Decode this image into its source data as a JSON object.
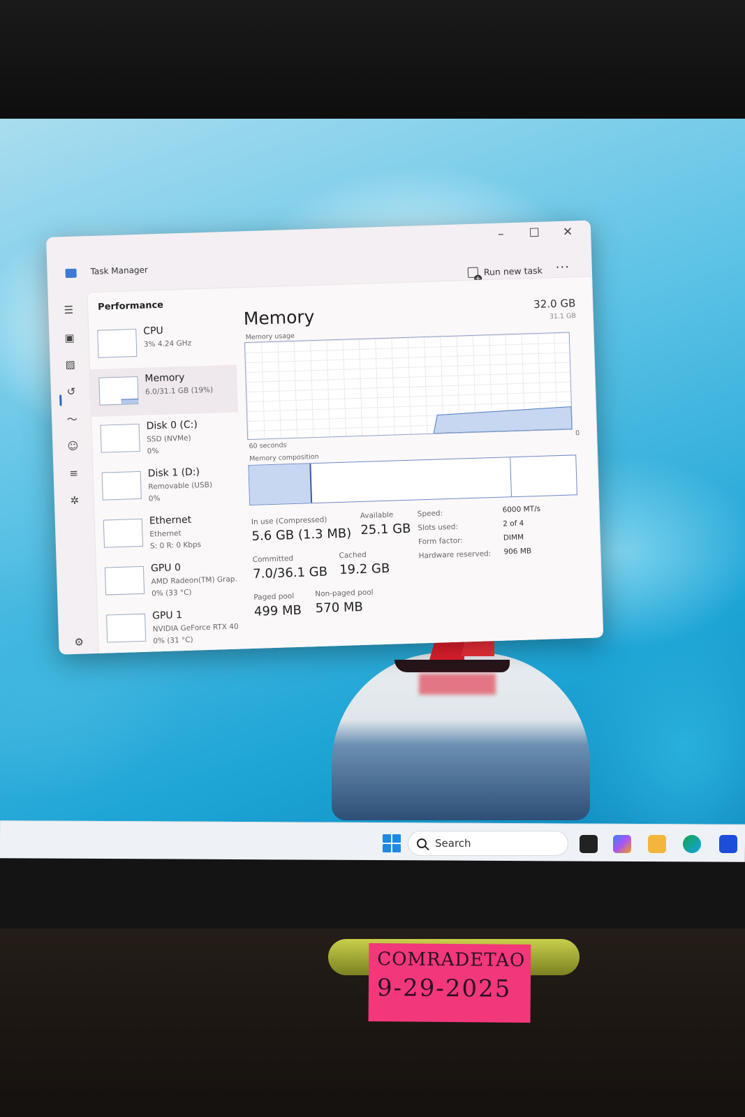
{
  "window": {
    "title": "Task Manager",
    "run_new_task": "Run new task",
    "more": "···",
    "minimize": "–",
    "maximize": "☐",
    "close": "✕"
  },
  "page": {
    "title": "Performance"
  },
  "sidebar": [
    {
      "name": "CPU",
      "sub": "3%  4.24 GHz",
      "sub2": "",
      "selected": false
    },
    {
      "name": "Memory",
      "sub": "6.0/31.1 GB (19%)",
      "sub2": "",
      "selected": true
    },
    {
      "name": "Disk 0 (C:)",
      "sub": "SSD (NVMe)",
      "sub2": "0%",
      "selected": false
    },
    {
      "name": "Disk 1 (D:)",
      "sub": "Removable (USB)",
      "sub2": "0%",
      "selected": false
    },
    {
      "name": "Ethernet",
      "sub": "Ethernet",
      "sub2": "S: 0  R: 0 Kbps",
      "selected": false
    },
    {
      "name": "GPU 0",
      "sub": "AMD Radeon(TM) Grap.",
      "sub2": "0%  (33 °C)",
      "selected": false
    },
    {
      "name": "GPU 1",
      "sub": "NVIDIA GeForce RTX 40",
      "sub2": "0%  (31 °C)",
      "selected": false
    }
  ],
  "memory": {
    "title": "Memory",
    "total": "32.0 GB",
    "usage_caption": "Memory usage",
    "max_label": "31.1 GB",
    "time_label": "60 seconds",
    "zero_label": "0",
    "composition_caption": "Memory composition",
    "in_use_fraction": 0.19,
    "stats": {
      "in_use_label": "In use (Compressed)",
      "in_use_value": "5.6 GB (1.3 MB)",
      "available_label": "Available",
      "available_value": "25.1 GB",
      "committed_label": "Committed",
      "committed_value": "7.0/36.1 GB",
      "cached_label": "Cached",
      "cached_value": "19.2 GB",
      "paged_label": "Paged pool",
      "paged_value": "499 MB",
      "nonpaged_label": "Non-paged pool",
      "nonpaged_value": "570 MB"
    },
    "specs": {
      "speed_label": "Speed:",
      "speed_value": "6000 MT/s",
      "slots_label": "Slots used:",
      "slots_value": "2 of 4",
      "form_label": "Form factor:",
      "form_value": "DIMM",
      "reserved_label": "Hardware reserved:",
      "reserved_value": "906 MB"
    }
  },
  "taskbar": {
    "search_placeholder": "Search"
  },
  "sticky_note": {
    "line1": "COMRADETAO",
    "line2": "9-29-2025"
  },
  "colors": {
    "accent": "#2a64c7",
    "graph_fill": "#b4c9ea",
    "sail": "#e5202e",
    "note": "#f2377a"
  }
}
